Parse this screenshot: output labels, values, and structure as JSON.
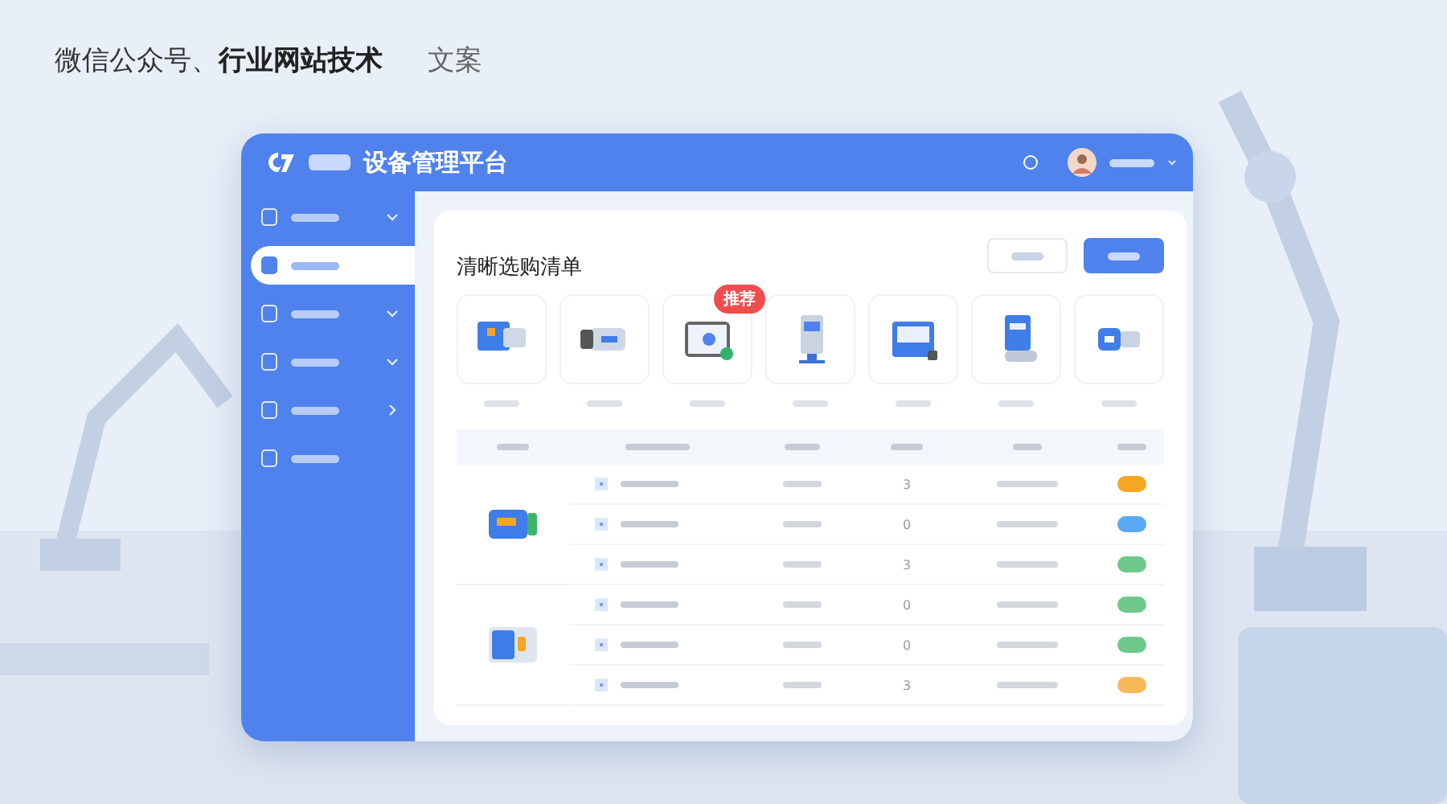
{
  "headline": {
    "plain": "微信公众号、",
    "bold": "行业网站技术",
    "tail": "文案"
  },
  "app": {
    "title": "设备管理平台"
  },
  "sidebar": {
    "items": [
      {
        "selected": false,
        "expanded": true
      },
      {
        "selected": true
      },
      {
        "selected": false,
        "expanded": true
      },
      {
        "selected": false,
        "expanded": true
      },
      {
        "selected": false,
        "expanded": false
      },
      {
        "selected": false
      }
    ]
  },
  "panel": {
    "title": "清晰选购清单",
    "buttons": [
      {
        "kind": "outline"
      },
      {
        "kind": "primary"
      }
    ]
  },
  "products": [
    {
      "kind": "folder"
    },
    {
      "kind": "camera"
    },
    {
      "kind": "safe",
      "badge": "推荐"
    },
    {
      "kind": "kiosk"
    },
    {
      "kind": "terminal"
    },
    {
      "kind": "tablet"
    },
    {
      "kind": "card"
    }
  ],
  "table": {
    "groups": [
      {
        "kind": "wallet"
      },
      {
        "kind": "panel"
      }
    ],
    "rows": [
      {
        "quantity": "3",
        "color": "#f5a623"
      },
      {
        "quantity": "0",
        "color": "#5aa9f5"
      },
      {
        "quantity": "3",
        "color": "#6cc98a"
      },
      {
        "quantity": "0",
        "color": "#6cc98a"
      },
      {
        "quantity": "0",
        "color": "#6cc98a"
      },
      {
        "quantity": "3",
        "color": "#f7b955"
      }
    ]
  }
}
